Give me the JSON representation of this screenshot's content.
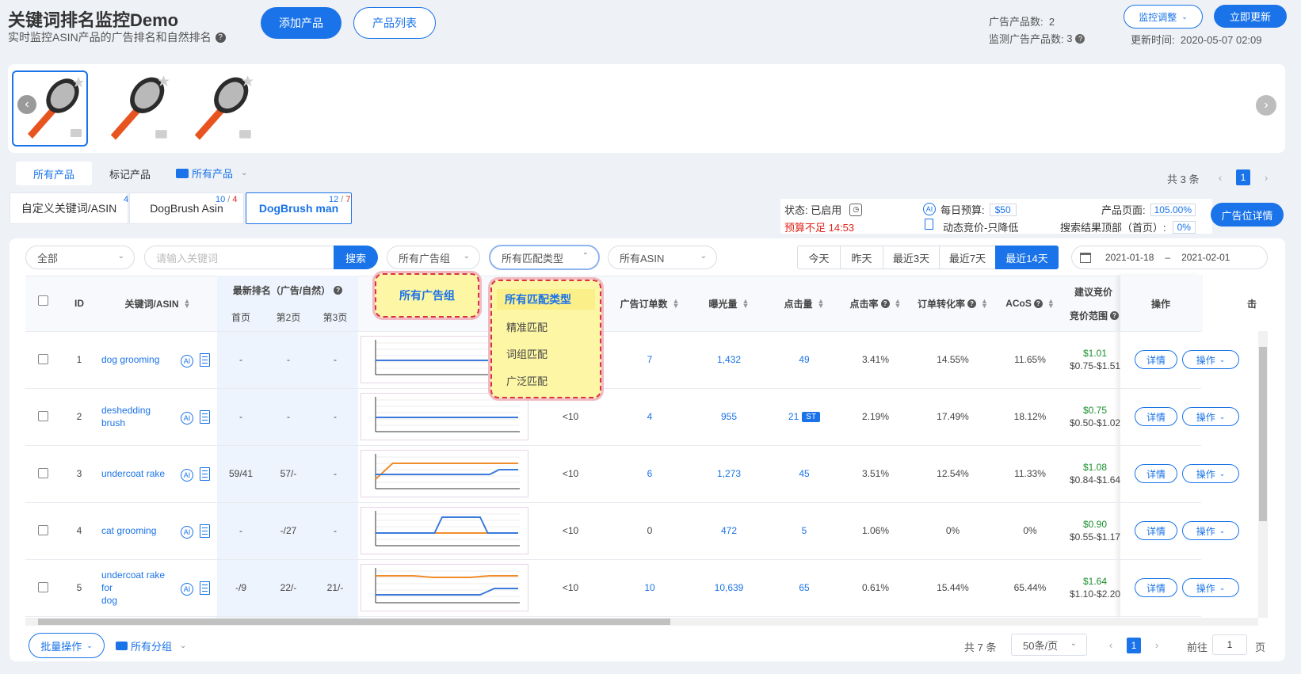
{
  "header": {
    "title": "关键词排名监控Demo",
    "subtitle": "实时监控ASIN产品的广告排名和自然排名",
    "add_product": "添加产品",
    "product_list": "产品列表",
    "ad_product_count_label": "广告产品数:",
    "ad_product_count": "2",
    "monitored_count_label": "监测广告产品数:",
    "monitored_count": "3",
    "monitor_adjust": "监控调整",
    "update_now": "立即更新",
    "update_time_label": "更新时间:",
    "update_time": "2020-05-07 02:09"
  },
  "product_tabs": {
    "all": "所有产品",
    "marked": "标记产品",
    "folder": "所有产品",
    "total": "共 3 条",
    "page": "1"
  },
  "keyword_tabs": [
    {
      "label": "自定义关键词/ASIN",
      "count_a": "4",
      "count_b": ""
    },
    {
      "label": "DogBrush Asin",
      "count_a": "10",
      "count_b": "4"
    },
    {
      "label": "DogBrush man",
      "count_a": "12",
      "count_b": "7"
    }
  ],
  "status": {
    "status_label": "状态:",
    "status_value": "已启用",
    "budget_warning": "预算不足 14:53",
    "daily_budget_label": "每日预算:",
    "daily_budget": "$50",
    "dynamic_bid": "动态竞价-只降低",
    "product_page_label": "产品页面:",
    "product_page_value": "105.00%",
    "search_top_label": "搜索结果顶部（首页）:",
    "search_top_value": "0%",
    "ad_detail": "广告位详情"
  },
  "filters": {
    "all": "全部",
    "keyword_placeholder": "请输入关键词",
    "search": "搜索",
    "ad_group": "所有广告组",
    "match_type": "所有匹配类型",
    "asin": "所有ASIN",
    "date_ranges": [
      "今天",
      "昨天",
      "最近3天",
      "最近7天",
      "最近14天"
    ],
    "date_start": "2021-01-18",
    "date_sep": "–",
    "date_end": "2021-02-01"
  },
  "callout": {
    "ad_group": "所有广告组",
    "match_title": "所有匹配类型",
    "match_options": [
      "精准匹配",
      "词组匹配",
      "广泛匹配"
    ]
  },
  "table": {
    "headers": {
      "id": "ID",
      "keyword": "关键词/ASIN",
      "rank": "最新排名（广告/自然）",
      "p1": "首页",
      "p2": "第2页",
      "p3": "第3页",
      "orders": "广告订单数",
      "impressions": "曝光量",
      "clicks": "点击量",
      "ctr": "点击率",
      "cvr": "订单转化率",
      "acos": "ACoS",
      "bid1": "建议竞价",
      "bid2": "竞价范围",
      "actions": "操作",
      "extra": "击"
    },
    "rows": [
      {
        "id": "1",
        "keyword": "dog grooming",
        "kw2": "",
        "p1": "-",
        "p2": "-",
        "p3": "-",
        "rank": "",
        "orders": "7",
        "impr": "1,432",
        "clicks": "49",
        "st": "",
        "ctr": "3.41%",
        "cvr": "14.55%",
        "acos": "11.65%",
        "bid": "$1.01",
        "range": "$0.75-$1.51"
      },
      {
        "id": "2",
        "keyword": "deshedding",
        "kw2": "brush",
        "p1": "-",
        "p2": "-",
        "p3": "-",
        "rank": "<10",
        "orders": "4",
        "impr": "955",
        "clicks": "21",
        "st": "ST",
        "ctr": "2.19%",
        "cvr": "17.49%",
        "acos": "18.12%",
        "bid": "$0.75",
        "range": "$0.50-$1.02"
      },
      {
        "id": "3",
        "keyword": "undercoat rake",
        "kw2": "",
        "p1": "59/41",
        "p2": "57/-",
        "p3": "-",
        "rank": "<10",
        "orders": "6",
        "impr": "1,273",
        "clicks": "45",
        "st": "",
        "ctr": "3.51%",
        "cvr": "12.54%",
        "acos": "11.33%",
        "bid": "$1.08",
        "range": "$0.84-$1.64"
      },
      {
        "id": "4",
        "keyword": "cat grooming",
        "kw2": "",
        "p1": "-",
        "p2": "-/27",
        "p3": "-",
        "rank": "<10",
        "orders": "0",
        "impr": "472",
        "clicks": "5",
        "st": "",
        "ctr": "1.06%",
        "cvr": "0%",
        "acos": "0%",
        "bid": "$0.90",
        "range": "$0.55-$1.17"
      },
      {
        "id": "5",
        "keyword": "undercoat rake for",
        "kw2": "dog",
        "p1": "-/9",
        "p2": "22/-",
        "p3": "21/-",
        "rank": "<10",
        "orders": "10",
        "impr": "10,639",
        "clicks": "65",
        "st": "",
        "ctr": "0.61%",
        "cvr": "15.44%",
        "acos": "65.44%",
        "bid": "$1.64",
        "range": "$1.10-$2.20"
      }
    ],
    "detail": "详情",
    "operate": "操作"
  },
  "footer": {
    "batch": "批量操作",
    "groups": "所有分组",
    "total": "共 7 条",
    "page_size": "50条/页",
    "page": "1",
    "goto": "前往",
    "goto_value": "1",
    "page_unit": "页"
  },
  "colors": {
    "accent": "#1a73e8",
    "warning": "#e0241b",
    "green": "#1a8f2e",
    "orange": "#f08c2a"
  }
}
